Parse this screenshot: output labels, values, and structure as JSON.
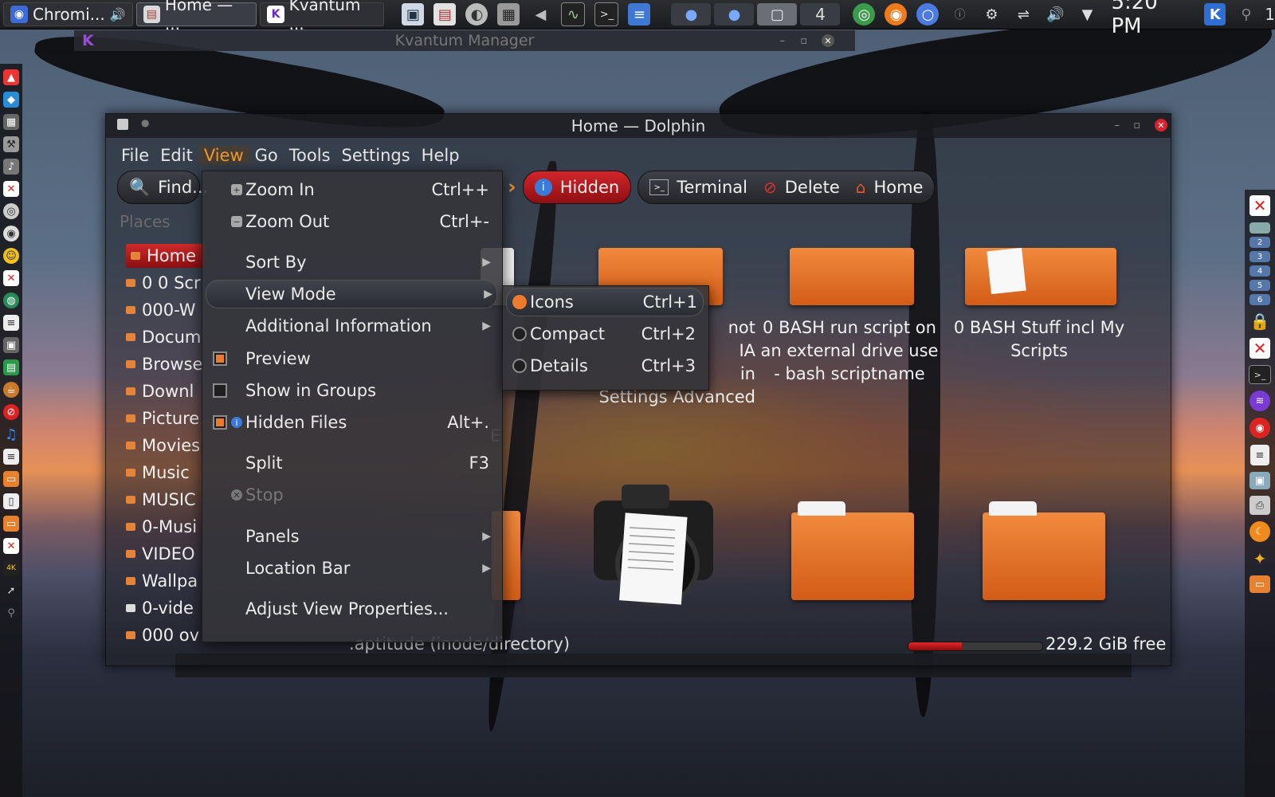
{
  "taskbar": {
    "tasks": [
      {
        "label": "Chromi...",
        "icon": "chromium-icon"
      },
      {
        "label": "Home — ...",
        "icon": "dolphin-icon"
      },
      {
        "label": "Kvantum ...",
        "icon": "kvantum-icon"
      }
    ],
    "desktop_number": "4",
    "clock": "5:20 PM",
    "screen_number": "1"
  },
  "kvantum_window": {
    "title": "Kvantum Manager"
  },
  "dolphin": {
    "title": "Home — Dolphin",
    "menubar": [
      "File",
      "Edit",
      "View",
      "Go",
      "Tools",
      "Settings",
      "Help"
    ],
    "active_menu": "View",
    "toolbar": {
      "find": "Find...",
      "hidden": "Hidden",
      "terminal": "Terminal",
      "delete": "Delete",
      "home": "Home"
    },
    "places": {
      "header": "Places",
      "items": [
        "Home",
        "0 0 Scr",
        "000-W",
        "Docum",
        "Browse",
        "Downl",
        "Picture",
        "Movies",
        "Music",
        "MUSIC",
        "0-Musi",
        "VIDEO",
        "Wallpa",
        "0-vide",
        "000 ov"
      ]
    },
    "files": [
      {
        "name": "not\nIA\nin\nSettings Advanced"
      },
      {
        "name": "0 BASH run script on\nan external drive use\n- bash scriptname"
      },
      {
        "name": "0 BASH Stuff incl My\nScripts"
      }
    ],
    "status": ".aptitude (inode/directory)",
    "disk_free": "229.2 GiB free",
    "disk_used_fraction": 0.4
  },
  "view_menu": {
    "items": {
      "zoom_in": {
        "label": "Zoom In",
        "shortcut": "Ctrl++"
      },
      "zoom_out": {
        "label": "Zoom Out",
        "shortcut": "Ctrl+-"
      },
      "sort_by": {
        "label": "Sort By"
      },
      "view_mode": {
        "label": "View Mode"
      },
      "additional_info": {
        "label": "Additional Information"
      },
      "preview": {
        "label": "Preview",
        "checked": true
      },
      "show_in_groups": {
        "label": "Show in Groups",
        "checked": false
      },
      "hidden_files": {
        "label": "Hidden Files",
        "shortcut": "Alt+.",
        "checked": true
      },
      "split": {
        "label": "Split",
        "shortcut": "F3"
      },
      "stop": {
        "label": "Stop",
        "disabled": true
      },
      "panels": {
        "label": "Panels"
      },
      "location_bar": {
        "label": "Location Bar"
      },
      "adjust": {
        "label": "Adjust View Properties..."
      }
    }
  },
  "view_mode_submenu": {
    "icons": {
      "label": "Icons",
      "shortcut": "Ctrl+1",
      "selected": true
    },
    "compact": {
      "label": "Compact",
      "shortcut": "Ctrl+2"
    },
    "details": {
      "label": "Details",
      "shortcut": "Ctrl+3"
    }
  },
  "colors": {
    "accent": "#ee7b2c",
    "highlight_red": "#d02a2a",
    "folder_orange": "#e97a30"
  }
}
